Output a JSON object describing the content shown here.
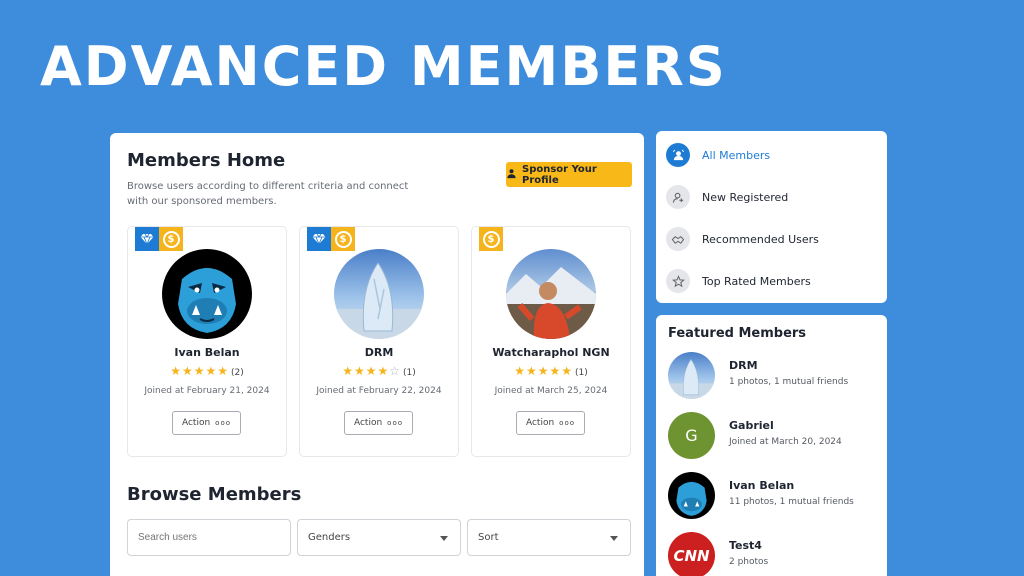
{
  "hero": {
    "title": "ADVANCED MEMBERS"
  },
  "main": {
    "title": "Members Home",
    "subtitle": "Browse users according to different criteria and connect with our sponsored members.",
    "sponsor_button": "Sponsor Your Profile",
    "cards": [
      {
        "name": "Ivan Belan",
        "rating": 5,
        "reviews": "(2)",
        "joined": "Joined at February 21, 2024",
        "action": "Action",
        "badges": [
          "verified",
          "sponsored"
        ]
      },
      {
        "name": "DRM",
        "rating": 4,
        "reviews": "(1)",
        "joined": "Joined at February 22, 2024",
        "action": "Action",
        "badges": [
          "verified",
          "sponsored"
        ]
      },
      {
        "name": "Watcharaphol NGN",
        "rating": 5,
        "reviews": "(1)",
        "joined": "Joined at March 25, 2024",
        "action": "Action",
        "badges": [
          "sponsored"
        ]
      }
    ],
    "browse_title": "Browse Members",
    "search_placeholder": "Search users",
    "genders_select": "Genders",
    "sort_select": "Sort"
  },
  "sidebar": {
    "nav": [
      {
        "label": "All Members",
        "icon": "members-icon",
        "active": true
      },
      {
        "label": "New Registered",
        "icon": "new-user-icon",
        "active": false
      },
      {
        "label": "Recommended Users",
        "icon": "recommended-icon",
        "active": false
      },
      {
        "label": "Top Rated Members",
        "icon": "star-icon",
        "active": false
      }
    ],
    "featured_title": "Featured Members",
    "featured": [
      {
        "name": "DRM",
        "sub": "1 photos, 1 mutual friends"
      },
      {
        "name": "Gabriel",
        "sub": "Joined at March 20, 2024",
        "initial": "G"
      },
      {
        "name": "Ivan Belan",
        "sub": "11 photos, 1 mutual friends"
      },
      {
        "name": "Test4",
        "sub": "2 photos",
        "logo_text": "CNN"
      }
    ]
  },
  "colors": {
    "background": "#3e8ddc",
    "accent": "#1d7bd3",
    "sponsor": "#f8b817",
    "star": "#f5b41c"
  }
}
